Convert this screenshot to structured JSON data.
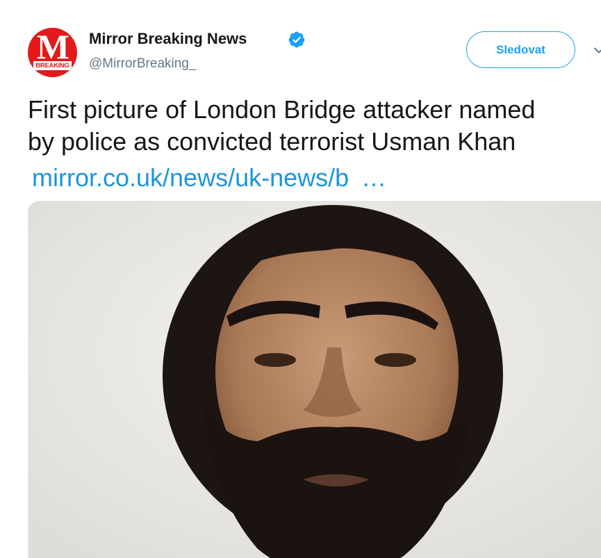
{
  "account": {
    "avatar_letter": "M",
    "avatar_tag": "BREAKING",
    "display_name": "Mirror Breaking News",
    "handle": "@MirrorBreaking_",
    "verified_icon": "verified-badge-icon"
  },
  "actions": {
    "follow_label": "Sledovat",
    "menu_icon": "chevron-down-icon"
  },
  "tweet": {
    "text_line_1": "First picture of London Bridge attacker named",
    "text_line_2": "by police as convicted terrorist Usman Khan",
    "link_text": "mirror.co.uk/news/uk-news/b",
    "link_ellipsis": "…"
  },
  "media": {
    "type": "photo"
  },
  "colors": {
    "brand_red": "#e3191b",
    "accent_blue": "#1da1f2",
    "link_blue": "#1b95e0",
    "text_primary": "#14171a",
    "text_secondary": "#657786"
  }
}
